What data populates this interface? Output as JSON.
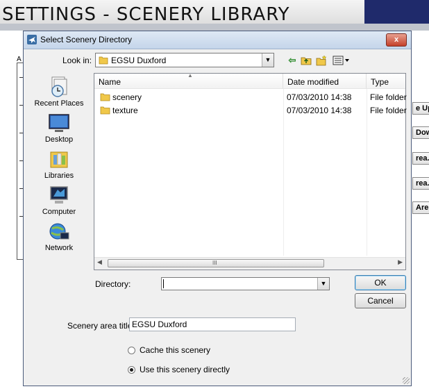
{
  "background_window": {
    "title": "SETTINGS - SCENERY LIBRARY",
    "left_label": "A",
    "side_buttons": [
      "e Up",
      "Dow",
      "rea..",
      "rea..",
      "Are"
    ]
  },
  "dialog": {
    "title": "Select Scenery Directory",
    "close_label": "x",
    "look_in": {
      "label": "Look in:",
      "value": "EGSU Duxford"
    },
    "toolbar_icons": [
      "back-icon",
      "up-folder-icon",
      "new-folder-icon",
      "view-menu-icon"
    ],
    "places": [
      {
        "label": "Recent Places",
        "icon": "recent-places-icon"
      },
      {
        "label": "Desktop",
        "icon": "desktop-icon"
      },
      {
        "label": "Libraries",
        "icon": "libraries-icon"
      },
      {
        "label": "Computer",
        "icon": "computer-icon"
      },
      {
        "label": "Network",
        "icon": "network-icon"
      }
    ],
    "file_list": {
      "columns": [
        "Name",
        "Date modified",
        "Type"
      ],
      "rows": [
        {
          "name": "scenery",
          "date": "07/03/2010 14:38",
          "type": "File folder"
        },
        {
          "name": "texture",
          "date": "07/03/2010 14:38",
          "type": "File folder"
        }
      ],
      "scroll_grip": "III"
    },
    "directory": {
      "label": "Directory:",
      "value": ""
    },
    "ok_label": "OK",
    "cancel_label": "Cancel",
    "scenery_area": {
      "label": "Scenery area title:",
      "value": "EGSU Duxford"
    },
    "options": [
      {
        "label": "Cache this scenery",
        "selected": false
      },
      {
        "label": "Use this scenery directly",
        "selected": true
      }
    ]
  }
}
